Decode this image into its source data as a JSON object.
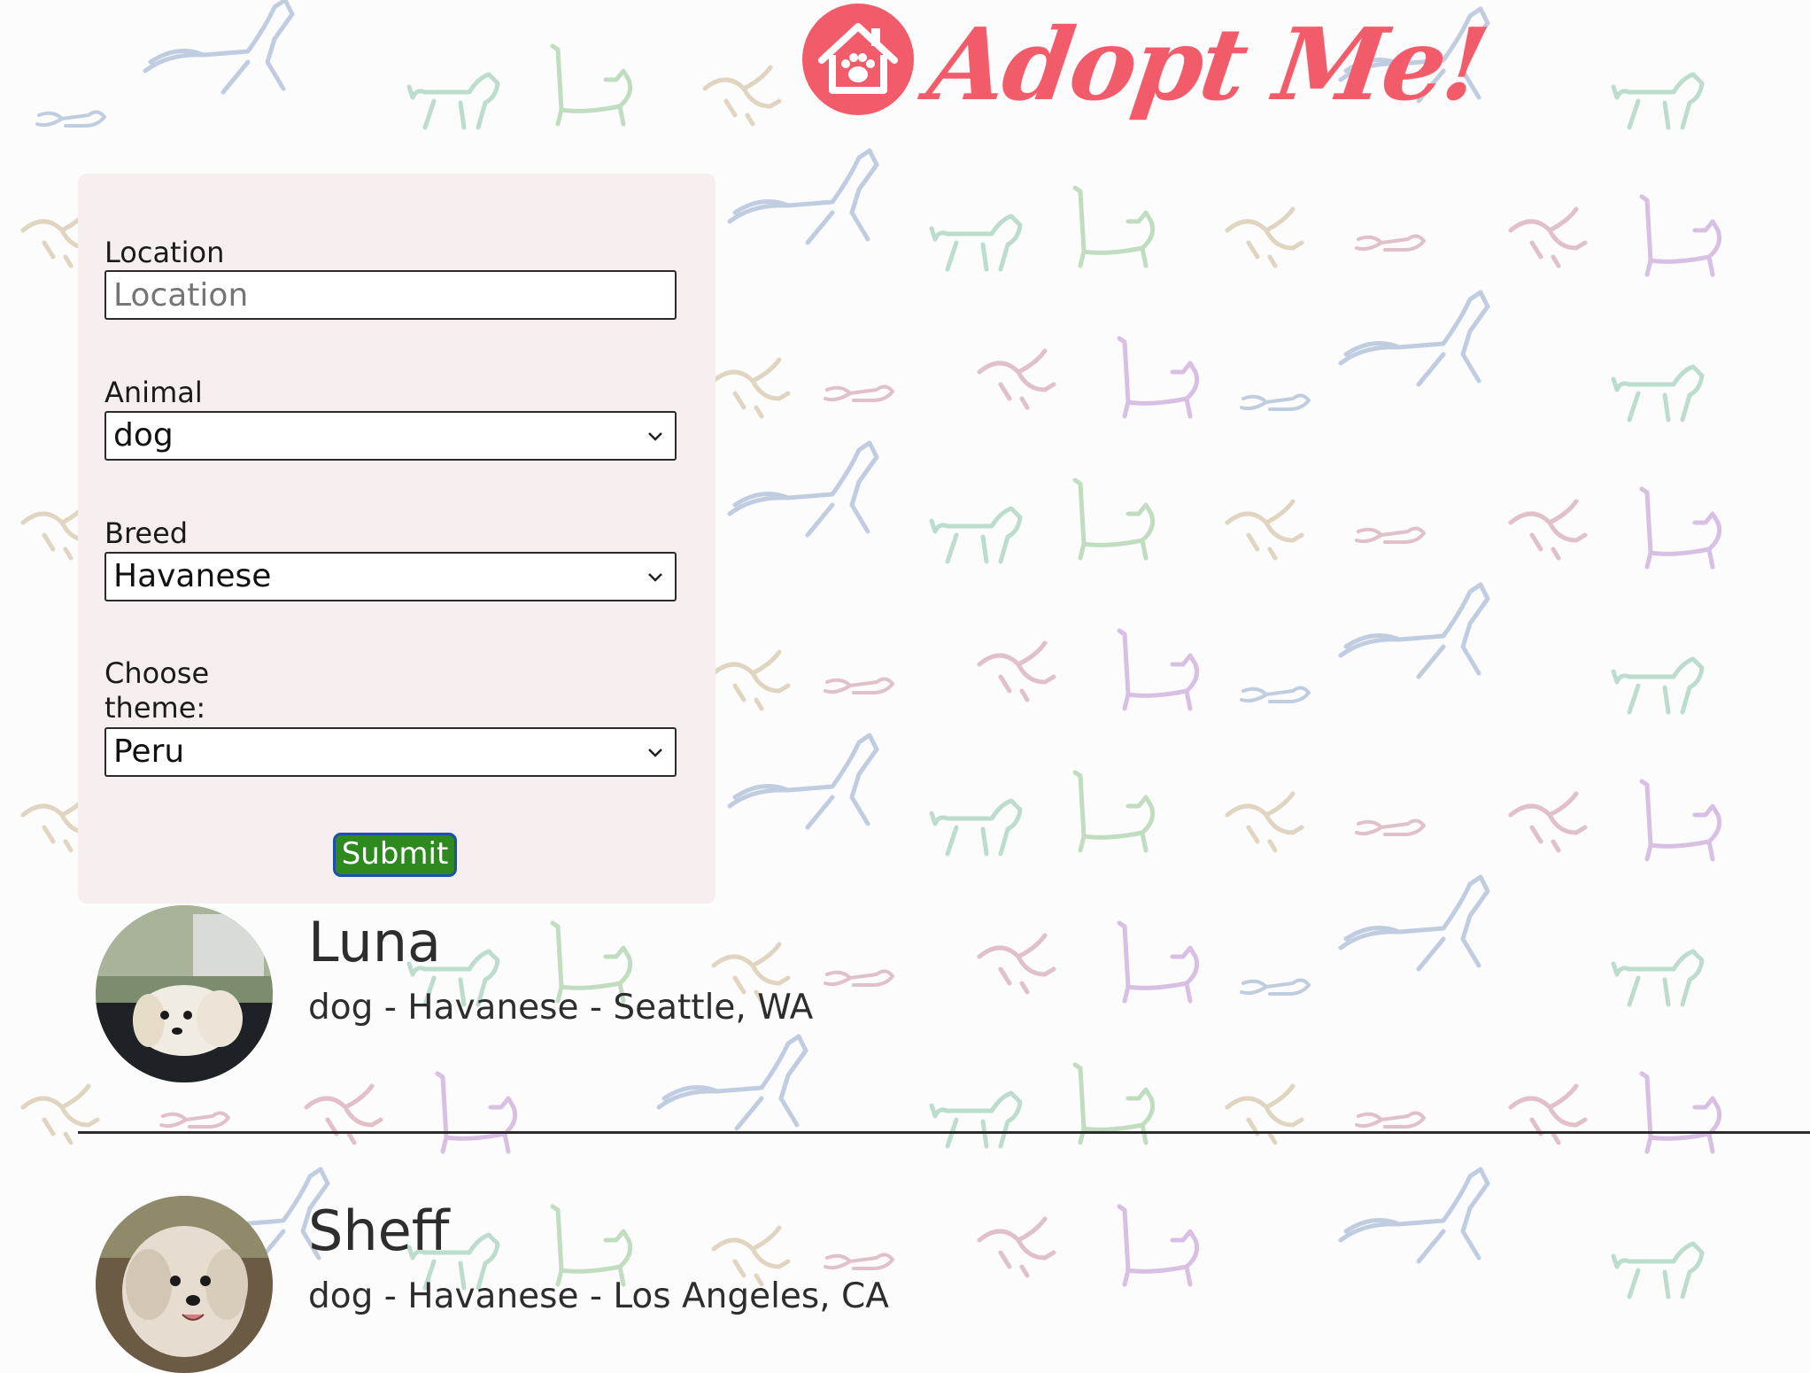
{
  "header": {
    "logo_text": "Adopt Me!"
  },
  "search_form": {
    "location": {
      "label": "Location",
      "value": "",
      "placeholder": "Location"
    },
    "animal": {
      "label": "Animal",
      "selected": "dog"
    },
    "breed": {
      "label": "Breed",
      "selected": "Havanese"
    },
    "theme": {
      "label_line1": "Choose",
      "label_line2": "theme:",
      "selected": "Peru"
    },
    "submit_label": "Submit"
  },
  "results": [
    {
      "name": "Luna",
      "info": "dog - Havanese - Seattle, WA"
    },
    {
      "name": "Sheff",
      "info": "dog - Havanese - Los Angeles, CA"
    }
  ],
  "colors": {
    "brand": "#f25c6a",
    "submit_bg": "#2e8a1f",
    "submit_border": "#1b4fb0",
    "panel_bg": "#f7efef"
  }
}
